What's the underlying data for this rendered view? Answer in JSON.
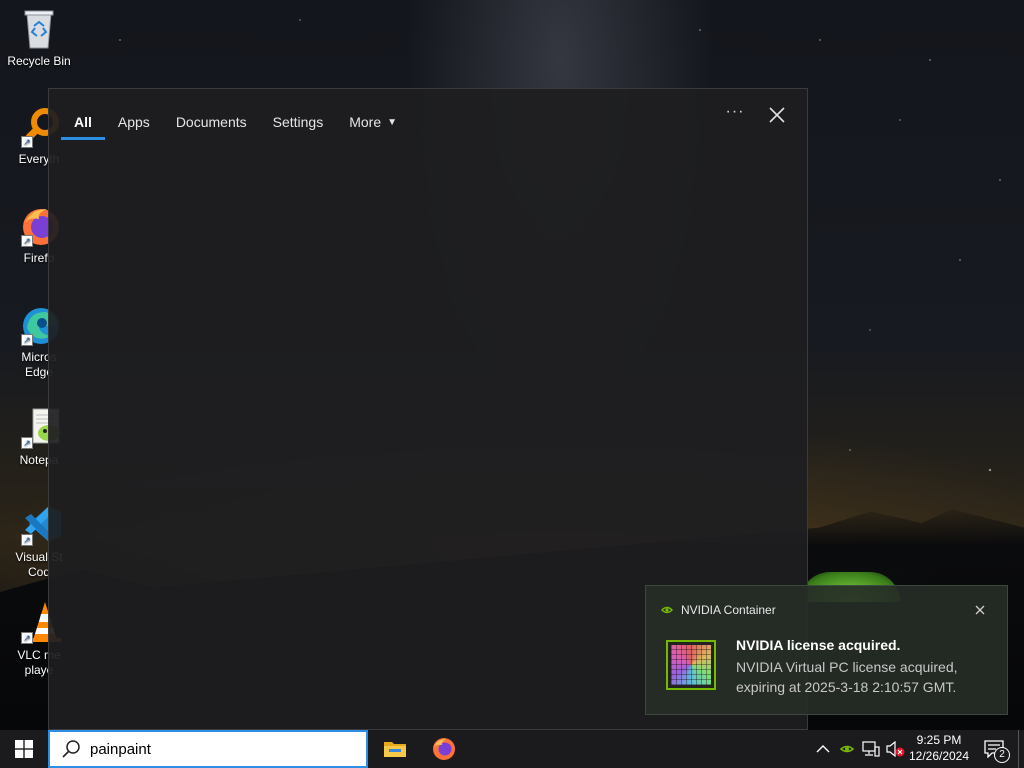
{
  "desktop": {
    "icons": [
      {
        "label": "Recycle Bin",
        "icon": "recycle-bin-icon"
      },
      {
        "label": "Everyth",
        "icon": "everything-search-icon"
      },
      {
        "label": "Firefo",
        "icon": "firefox-icon"
      },
      {
        "label": "Micros Edge",
        "label_line1": "Micros",
        "label_line2": "Edge",
        "icon": "edge-icon"
      },
      {
        "label": "Notepa",
        "icon": "notepad-plus-plus-icon"
      },
      {
        "label": "Visual St Cod",
        "label_line1": "Visual St",
        "label_line2": "Cod",
        "icon": "vscode-icon"
      },
      {
        "label": "VLC me playe",
        "label_line1": "VLC me",
        "label_line2": "playe",
        "icon": "vlc-icon"
      }
    ]
  },
  "search_panel": {
    "tabs": [
      {
        "label": "All",
        "active": true
      },
      {
        "label": "Apps",
        "active": false
      },
      {
        "label": "Documents",
        "active": false
      },
      {
        "label": "Settings",
        "active": false
      },
      {
        "label": "More",
        "active": false,
        "has_dropdown": true
      }
    ],
    "options_glyph": "···",
    "close_icon": "close-icon"
  },
  "toast": {
    "app_name": "NVIDIA Container",
    "title": "NVIDIA license acquired.",
    "body": "NVIDIA Virtual PC license acquired, expiring at 2025-3-18 2:10:57 GMT.",
    "accent": "#76b900"
  },
  "taskbar": {
    "search_value": "painpaint",
    "pinned": [
      {
        "name": "file-explorer",
        "icon": "folder-icon"
      },
      {
        "name": "firefox",
        "icon": "firefox-icon"
      }
    ],
    "tray": {
      "time": "9:25 PM",
      "date": "12/26/2024",
      "notification_count": "2"
    }
  },
  "colors": {
    "accent_blue": "#2d8fe4",
    "nvidia_green": "#76b900",
    "taskbar_bg": "#1b1b1e"
  }
}
